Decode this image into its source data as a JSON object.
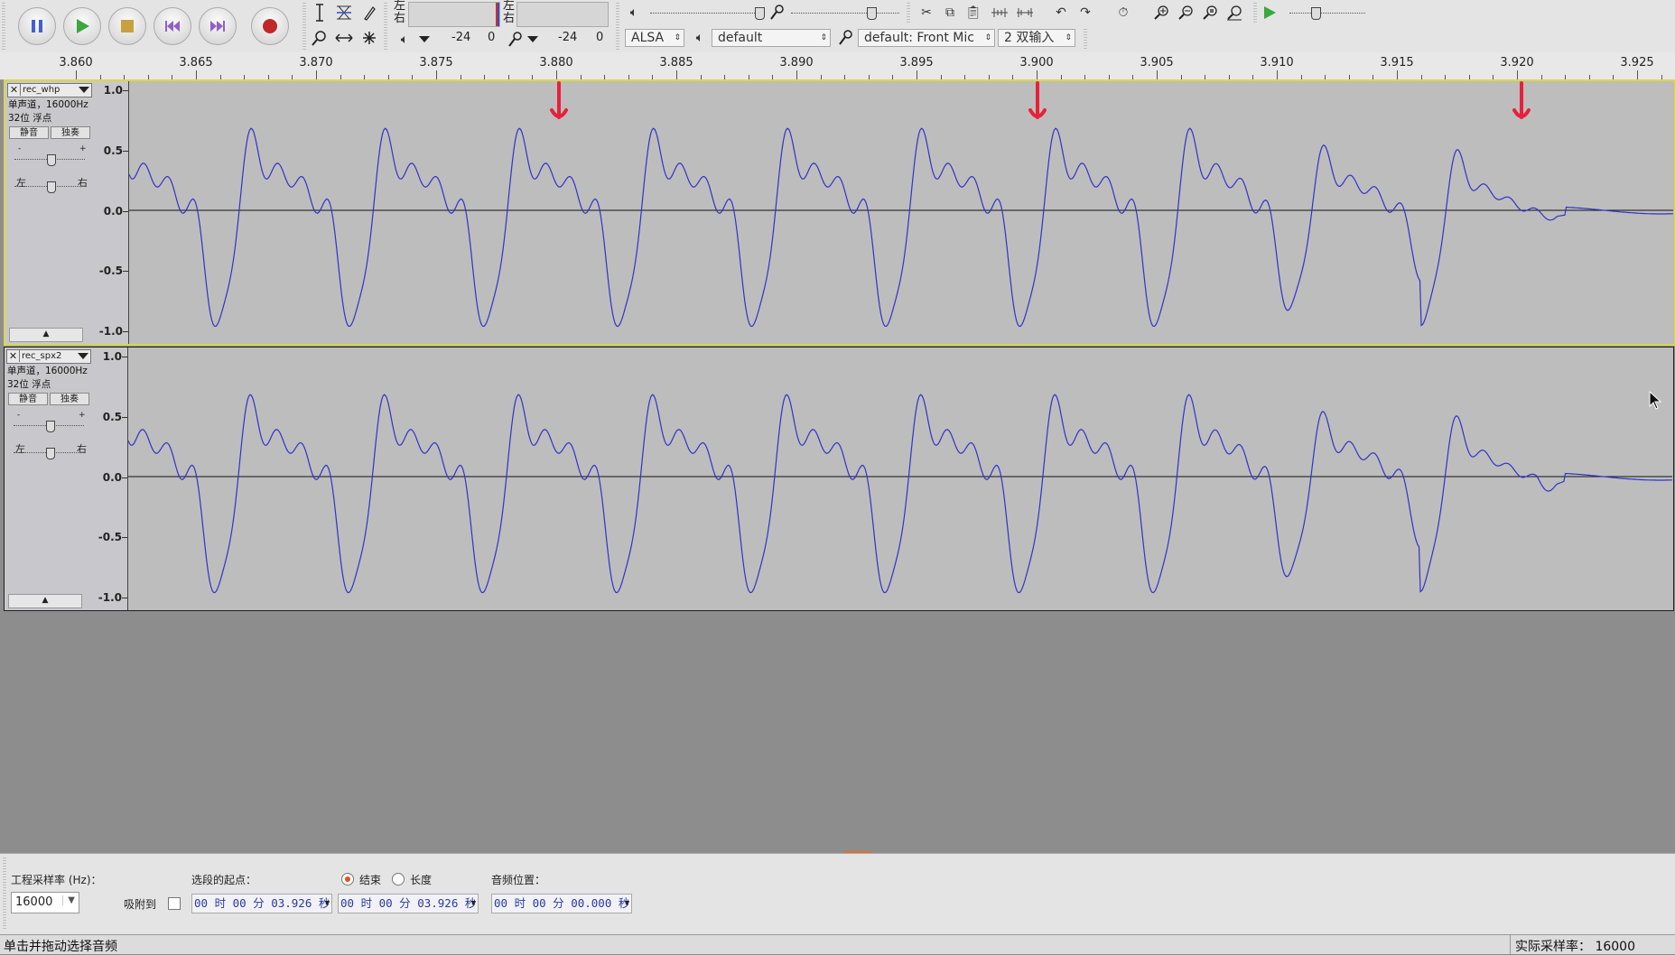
{
  "toolbar": {
    "meter_left": "左",
    "meter_right": "右",
    "meter_db_1": "-24",
    "meter_zero_1": "0",
    "meter_db_2": "-24",
    "meter_zero_2": "0",
    "host": "ALSA",
    "playback_device": "default",
    "recording_device": "default: Front Mic",
    "channels": "2 双输入"
  },
  "ruler": {
    "ticks": [
      "3.860",
      "3.865",
      "3.870",
      "3.875",
      "3.880",
      "3.885",
      "3.890",
      "3.895",
      "3.900",
      "3.905",
      "3.910",
      "3.915",
      "3.920",
      "3.925"
    ]
  },
  "tracks": [
    {
      "name": "rec_whp",
      "info1": "单声道，16000Hz",
      "info2": "32位 浮点",
      "mute": "静音",
      "solo": "独奏",
      "gain_minus": "-",
      "gain_plus": "+",
      "pan_left": "左",
      "pan_right": "右"
    },
    {
      "name": "rec_spx2",
      "info1": "单声道，16000Hz",
      "info2": "32位 浮点",
      "mute": "静音",
      "solo": "独奏",
      "gain_minus": "-",
      "gain_plus": "+",
      "pan_left": "左",
      "pan_right": "右"
    }
  ],
  "vruler_labels": [
    "1.0",
    "0.5",
    "0.0",
    "-0.5",
    "-1.0"
  ],
  "bottom": {
    "project_rate_label": "工程采样率 (Hz)：",
    "project_rate": "16000",
    "snap_label": "吸附到",
    "sel_start_label": "选段的起点：",
    "end_label": "结束",
    "length_label": "长度",
    "audio_pos_label": "音频位置：",
    "sel_start": "00 时 00 分 03.926 秒",
    "sel_end": "00 时 00 分 03.926 秒",
    "audio_pos": "00 时 00 分 00.000 秒"
  },
  "status": {
    "left": "单击并拖动选择音频",
    "right": "实际采样率： 16000"
  },
  "colors": {
    "waveform": "#3232c8",
    "marker": "#e8203a",
    "selected_border": "#d8d84a"
  }
}
